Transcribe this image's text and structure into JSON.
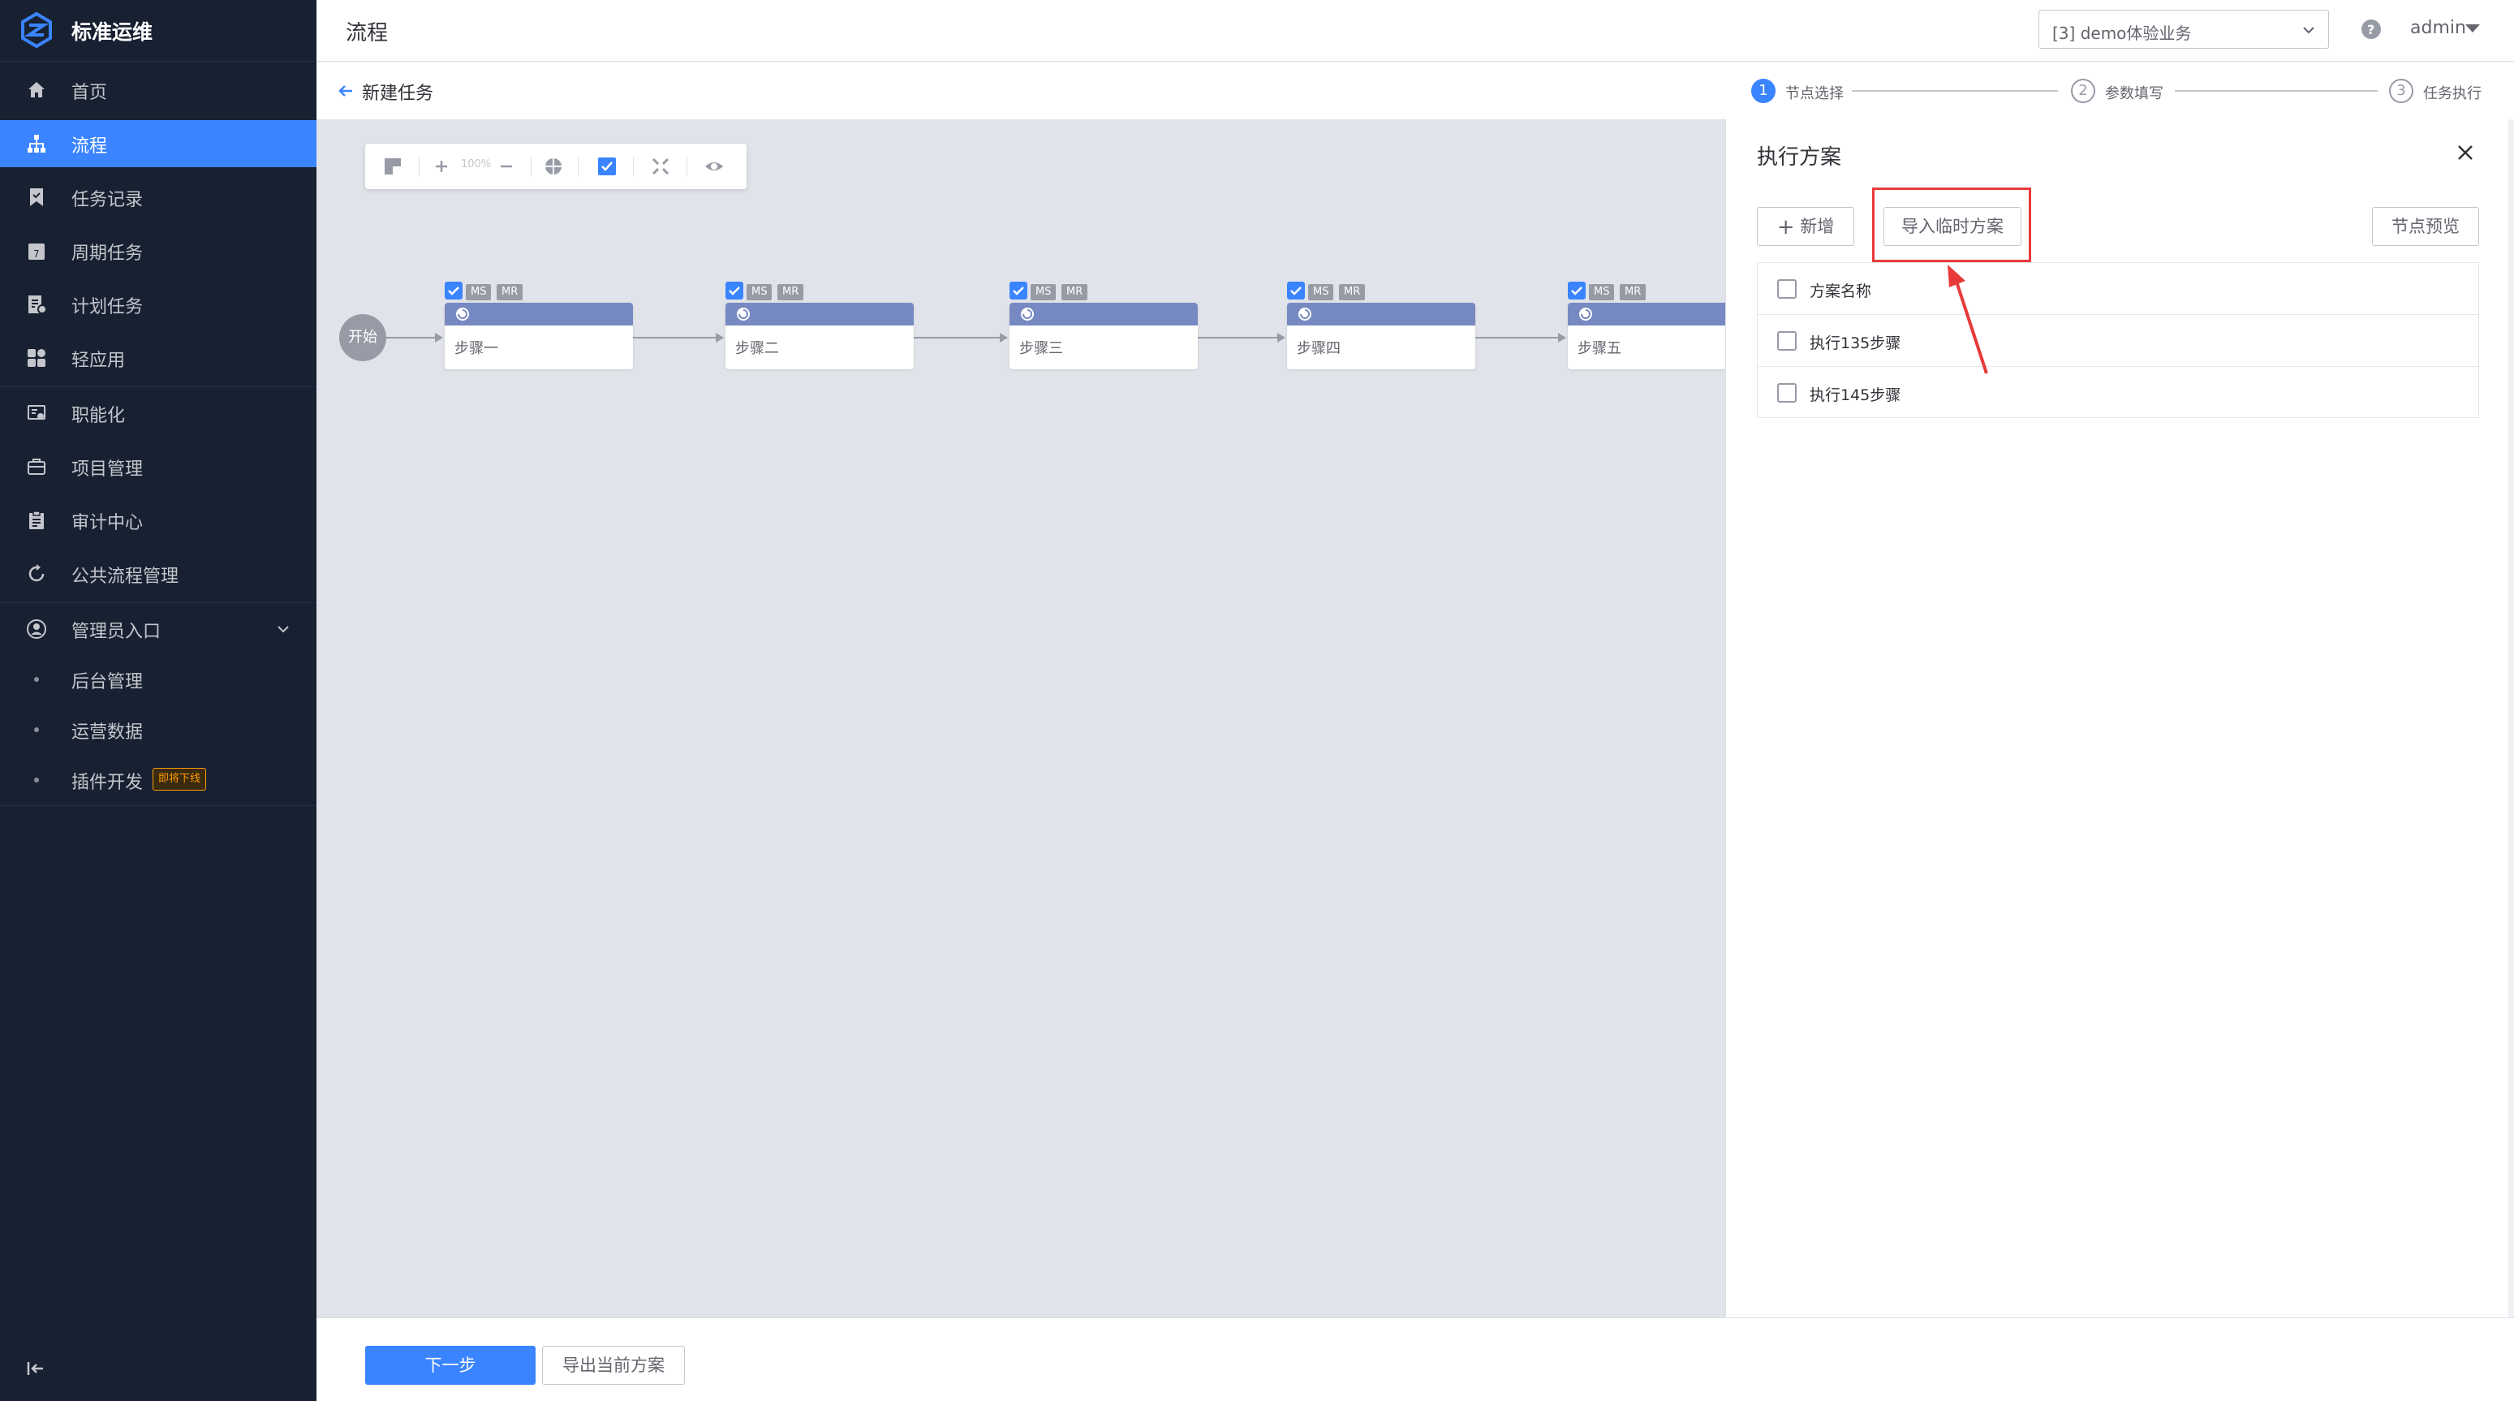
{
  "app": {
    "logo_text": "标准运维"
  },
  "sidebar": {
    "items": [
      {
        "label": "首页",
        "icon": "home-icon"
      },
      {
        "label": "流程",
        "icon": "flow-icon",
        "active": true
      },
      {
        "label": "任务记录",
        "icon": "bookmark-icon"
      },
      {
        "label": "周期任务",
        "icon": "calendar-icon"
      },
      {
        "label": "计划任务",
        "icon": "plan-icon"
      },
      {
        "label": "轻应用",
        "icon": "apps-icon"
      },
      {
        "label": "职能化",
        "icon": "function-icon"
      },
      {
        "label": "项目管理",
        "icon": "briefcase-icon"
      },
      {
        "label": "审计中心",
        "icon": "clipboard-icon"
      },
      {
        "label": "公共流程管理",
        "icon": "cycle-icon"
      }
    ],
    "admin": {
      "label": "管理员入口",
      "icon": "user-circle-icon",
      "children": [
        {
          "label": "后台管理"
        },
        {
          "label": "运营数据"
        },
        {
          "label": "插件开发",
          "badge": "即将下线"
        }
      ]
    }
  },
  "header": {
    "title": "流程",
    "business_select": "[3] demo体验业务",
    "user": "admin"
  },
  "subheader": {
    "back_label": "新建任务",
    "steps": [
      {
        "num": "1",
        "label": "节点选择",
        "active": true
      },
      {
        "num": "2",
        "label": "参数填写"
      },
      {
        "num": "3",
        "label": "任务执行"
      }
    ]
  },
  "canvas": {
    "zoom": "100%",
    "start_label": "开始",
    "nodes": [
      {
        "label": "步骤一",
        "tags": [
          "MS",
          "MR"
        ]
      },
      {
        "label": "步骤二",
        "tags": [
          "MS",
          "MR"
        ]
      },
      {
        "label": "步骤三",
        "tags": [
          "MS",
          "MR"
        ]
      },
      {
        "label": "步骤四",
        "tags": [
          "MS",
          "MR"
        ]
      },
      {
        "label": "步骤五",
        "tags": [
          "MS",
          "MR"
        ]
      }
    ]
  },
  "panel": {
    "title": "执行方案",
    "add_button": "新增",
    "import_button": "导入临时方案",
    "preview_button": "节点预览",
    "list_header": "方案名称",
    "plans": [
      "执行135步骤",
      "执行145步骤"
    ]
  },
  "footer": {
    "next_button": "下一步",
    "export_button": "导出当前方案"
  },
  "colors": {
    "sidebar_bg": "#182132",
    "accent": "#3a84ff",
    "node_header": "#7789c2",
    "highlight": "#e83a3a"
  }
}
